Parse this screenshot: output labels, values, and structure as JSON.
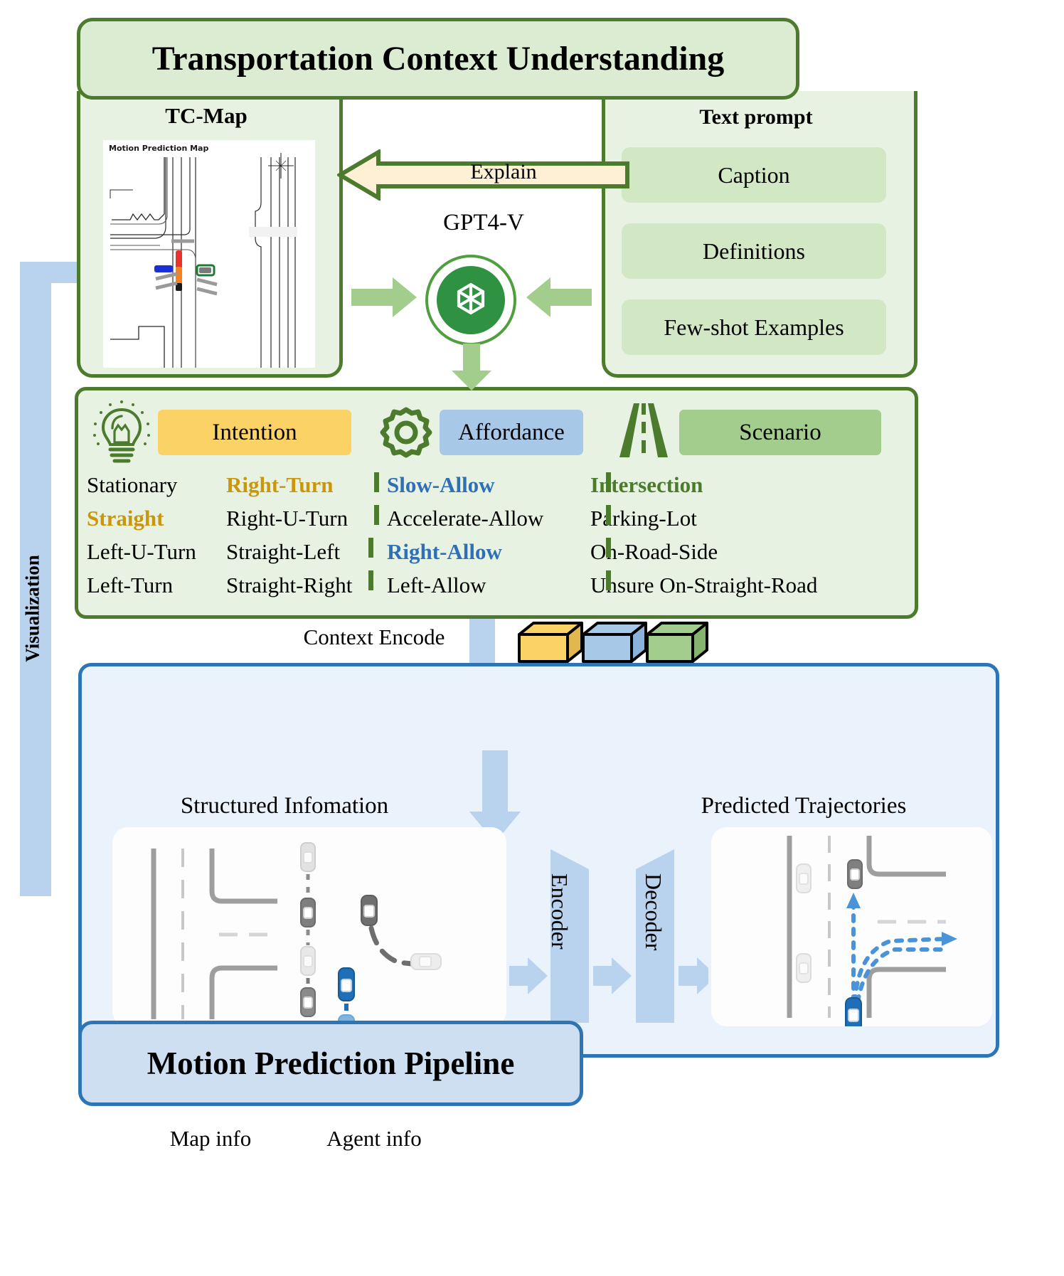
{
  "left_flow": {
    "label": "Visualization"
  },
  "header": {
    "title": "Transportation Context Understanding"
  },
  "tcmap": {
    "title": "TC-Map",
    "image_caption": "Motion Prediction Map"
  },
  "prompt": {
    "title": "Text prompt",
    "items": [
      {
        "label": "Caption"
      },
      {
        "label": "Definitions"
      },
      {
        "label": "Few-shot Examples"
      }
    ]
  },
  "explain_arrow": {
    "label": "Explain"
  },
  "model": {
    "label": "GPT4-V",
    "logo_icon": "openai-logo-icon"
  },
  "categories": {
    "intention": {
      "badge": "Intention",
      "icon": "lightbulb-icon",
      "badge_color": "#fbd266",
      "highlight_color": "#c9960c",
      "column1": [
        "Stationary",
        "Straight",
        "Left-U-Turn",
        "Left-Turn"
      ],
      "column2": [
        "Right-Turn",
        "Right-U-Turn",
        "Straight-Left",
        "Straight-Right"
      ],
      "highlighted": [
        "Right-Turn",
        "Straight"
      ]
    },
    "affordance": {
      "badge": "Affordance",
      "icon": "gear-icon",
      "badge_color": "#a8c8e8",
      "highlight_color": "#2e6fb7",
      "items": [
        "Slow-Allow",
        "Accelerate-Allow",
        "Right-Allow",
        "Left-Allow"
      ],
      "highlighted": [
        "Slow-Allow",
        "Right-Allow"
      ]
    },
    "scenario": {
      "badge": "Scenario",
      "icon": "road-icon",
      "badge_color": "#a2cd8c",
      "highlight_color": "#4d7b2e",
      "items": [
        "Intersection",
        "Parking-Lot",
        "On-Road-Side",
        "Unsure  On-Straight-Road"
      ],
      "highlighted": [
        "Intersection"
      ]
    }
  },
  "context_encode": {
    "label": "Context Encode",
    "cube_colors": [
      "#fbd266",
      "#a8c8e8",
      "#a2cd8c"
    ]
  },
  "pipeline": {
    "title": "Motion Prediction Pipeline",
    "left_panel_label": "Structured Infomation",
    "right_panel_label": "Predicted Trajectories",
    "map_info_label": "Map info",
    "agent_info_label": "Agent info",
    "encoder_label": "Encoder",
    "decoder_label": "Decoder"
  },
  "colors": {
    "green_border": "#4d7b2e",
    "green_fill": "#e8f2e2",
    "green_banner": "#dcecd2",
    "blue_border": "#2e75b6",
    "blue_fill": "#eaf2fb",
    "blue_banner": "#cfdff2",
    "arrow_blue": "#b9d3ee",
    "explain_fill": "#fdf0d5"
  }
}
